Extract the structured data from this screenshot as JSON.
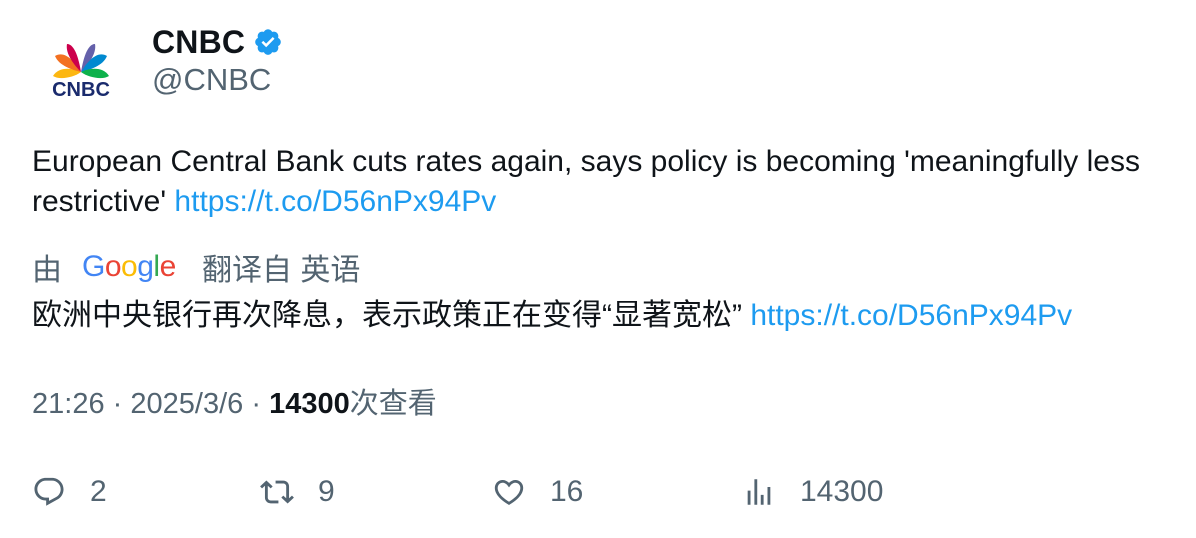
{
  "author": {
    "display_name": "CNBC",
    "handle": "@CNBC",
    "logo_text": "CNBC",
    "verified": true,
    "avatar_icon": "cnbc-peacock-logo",
    "verified_icon": "verified-badge-icon"
  },
  "tweet": {
    "text": "European Central Bank cuts rates again, says policy is becoming 'meaningfully less restrictive' ",
    "link": "https://t.co/D56nPx94Pv"
  },
  "translation": {
    "prefix": "由",
    "provider": "Google",
    "suffix": "翻译自 英语",
    "text": "欧洲中央银行再次降息，表示政策正在变得“显著宽松” ",
    "link": "https://t.co/D56nPx94Pv"
  },
  "meta": {
    "time": "21:26",
    "separator": "·",
    "date": "2025/3/6",
    "views_count": "14300",
    "views_label": "次查看"
  },
  "actions": {
    "reply": {
      "icon": "reply-icon",
      "count": "2"
    },
    "retweet": {
      "icon": "retweet-icon",
      "count": "9"
    },
    "like": {
      "icon": "heart-icon",
      "count": "16"
    },
    "views": {
      "icon": "analytics-icon",
      "count": "14300"
    }
  },
  "colors": {
    "link": "#1d9bf0",
    "secondary_text": "#536471",
    "primary_text": "#0f1419",
    "verified": "#1d9bf0"
  }
}
